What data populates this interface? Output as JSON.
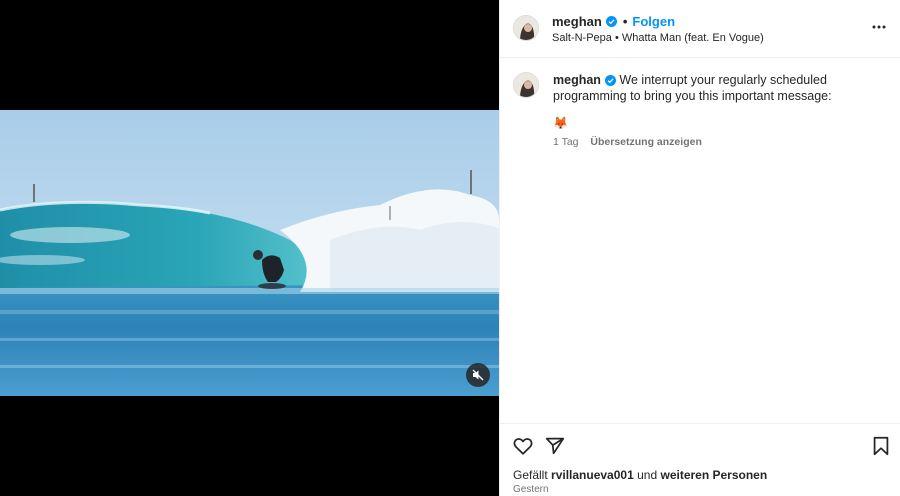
{
  "post": {
    "username": "meghan",
    "dot": "•",
    "follow_label": "Folgen",
    "audio": "Salt-N-Pepa • Whatta Man (feat. En Vogue)"
  },
  "caption": {
    "username": "meghan",
    "text": "We interrupt your regularly scheduled programming to bring you this important message:",
    "emoji": "🦊",
    "age": "1 Tag",
    "translate_label": "Übersetzung anzeigen"
  },
  "footer": {
    "likes_prefix": "Gefällt",
    "liked_by": "rvillanueva001",
    "likes_middle": "und",
    "likes_others": "weiteren Personen",
    "date": "Gestern"
  },
  "icons": {
    "verified": "verified-badge-icon",
    "more": "more-options-icon",
    "like": "heart-icon",
    "share": "paper-plane-icon",
    "save": "bookmark-icon",
    "mute": "speaker-muted-icon"
  },
  "colors": {
    "accent": "#0095f6",
    "text": "#262626",
    "muted": "#737373"
  }
}
